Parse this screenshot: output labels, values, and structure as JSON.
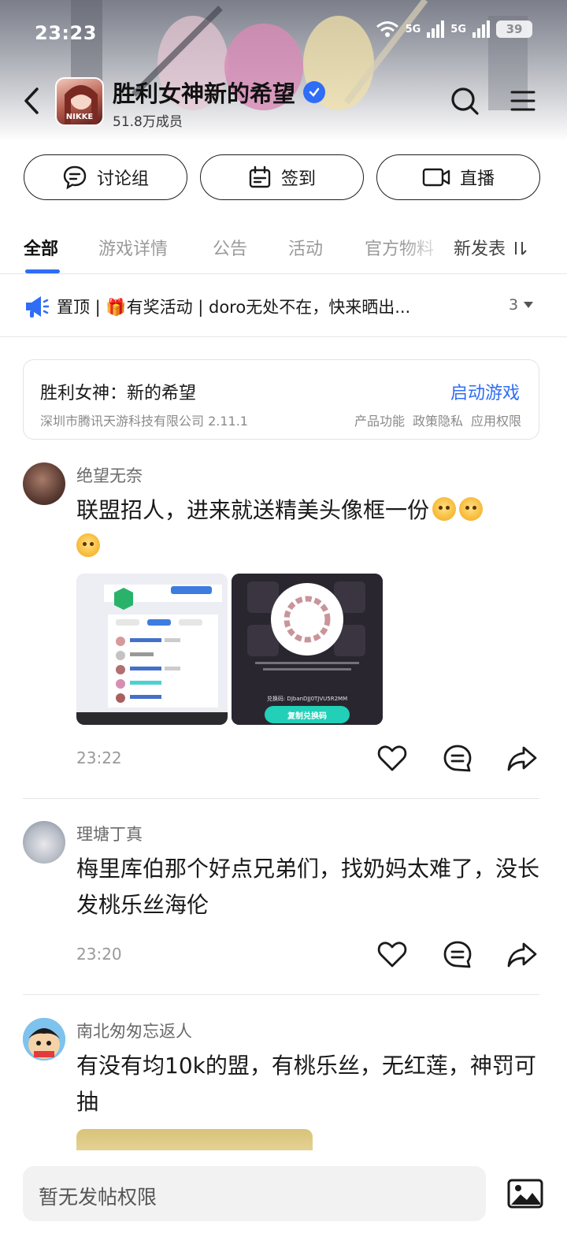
{
  "status_bar": {
    "time": "23:23",
    "signal1": "5G",
    "signal2": "5G",
    "battery": "39"
  },
  "header": {
    "title": "胜利女神新的希望",
    "members": "51.8万成员",
    "icon_text": "NIKKE"
  },
  "actions": [
    {
      "label": "讨论组",
      "icon": "chat-bubble-icon"
    },
    {
      "label": "签到",
      "icon": "calendar-icon"
    },
    {
      "label": "直播",
      "icon": "video-camera-icon"
    }
  ],
  "tabs": [
    {
      "label": "全部",
      "active": true
    },
    {
      "label": "游戏详情",
      "active": false
    },
    {
      "label": "公告",
      "active": false
    },
    {
      "label": "活动",
      "active": false
    },
    {
      "label": "官方物料",
      "active": false
    }
  ],
  "sort_label": "新发表",
  "pinned": {
    "text": "置顶 | 🎁有奖活动 | doro无处不在，快来晒出...",
    "count": "3"
  },
  "game_card": {
    "title": "胜利女神：新的希望",
    "publisher": "深圳市腾讯天游科技有限公司 2.11.1",
    "launch": "启动游戏",
    "links": [
      "产品功能",
      "政策隐私",
      "应用权限"
    ]
  },
  "posts": [
    {
      "author": "绝望无奈",
      "content": "联盟招人，进来就送精美头像框一份",
      "time": "23:22",
      "img_redeem_label": "复制兑换码",
      "img_redeem_code": "兑换码: DJbanDJJ0TJVU5R2MM"
    },
    {
      "author": "理塘丁真",
      "content": "梅里库伯那个好点兄弟们，找奶妈太难了，没长发桃乐丝海伦",
      "time": "23:20"
    },
    {
      "author": "南北匆匆忘返人",
      "content": "有没有均10k的盟，有桃乐丝，无红莲，神罚可抽"
    }
  ],
  "compose": {
    "placeholder": "暂无发帖权限"
  },
  "colors": {
    "accent": "#2f6df6"
  }
}
